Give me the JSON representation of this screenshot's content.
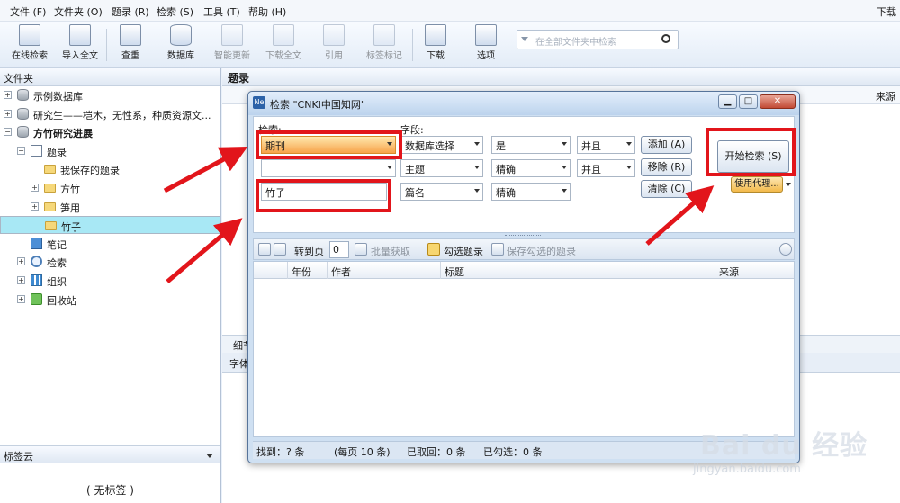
{
  "menubar": {
    "items": [
      "文件 (F)",
      "文件夹 (O)",
      "题录 (R)",
      "检索 (S)",
      "工具 (T)",
      "帮助 (H)"
    ],
    "right_text": "下载量"
  },
  "toolbar": {
    "buttons": [
      {
        "label": "在线检索",
        "icon": "online-search-icon",
        "enabled": true
      },
      {
        "label": "导入全文",
        "icon": "import-fulltext-icon",
        "enabled": true
      },
      {
        "label": "查重",
        "icon": "dedupe-icon",
        "enabled": true
      },
      {
        "label": "数据库",
        "icon": "database-icon",
        "enabled": true
      },
      {
        "label": "智能更新",
        "icon": "smart-update-icon",
        "enabled": false
      },
      {
        "label": "下载全文",
        "icon": "download-fulltext-icon",
        "enabled": false
      },
      {
        "label": "引用",
        "icon": "cite-icon",
        "enabled": false
      },
      {
        "label": "标签标记",
        "icon": "tag-icon",
        "enabled": false
      },
      {
        "label": "下载",
        "icon": "download-icon",
        "enabled": true
      },
      {
        "label": "选项",
        "icon": "options-icon",
        "enabled": true
      }
    ],
    "search_placeholder": "在全部文件夹中检索"
  },
  "left_panel": {
    "header": "文件夹",
    "tree": [
      {
        "label": "示例数据库",
        "icon": "database-icon",
        "level": 0,
        "expander": "+"
      },
      {
        "label": "研究生——桤木，无性系，种质资源文...",
        "icon": "database-icon",
        "level": 0,
        "expander": "+"
      },
      {
        "label": "方竹研究进展",
        "icon": "database-icon",
        "level": 0,
        "expander": "−",
        "bold": true
      },
      {
        "label": "题录",
        "icon": "list-icon",
        "level": 1,
        "expander": "−"
      },
      {
        "label": "我保存的题录",
        "icon": "folder-icon",
        "level": 2,
        "expander": ""
      },
      {
        "label": "方竹",
        "icon": "folder-icon",
        "level": 2,
        "expander": "+"
      },
      {
        "label": "笋用",
        "icon": "folder-icon",
        "level": 2,
        "expander": "+"
      },
      {
        "label": "竹子",
        "icon": "folder-icon",
        "level": 2,
        "expander": "",
        "selected": true
      },
      {
        "label": "笔记",
        "icon": "note-icon",
        "level": 1,
        "expander": ""
      },
      {
        "label": "检索",
        "icon": "search-icon",
        "level": 1,
        "expander": "+"
      },
      {
        "label": "组织",
        "icon": "organize-icon",
        "level": 1,
        "expander": "+"
      },
      {
        "label": "回收站",
        "icon": "recycle-bin-icon",
        "level": 1,
        "expander": "+"
      }
    ],
    "tagcloud_header": "标签云",
    "tagcloud_empty": "( 无标签 )"
  },
  "main": {
    "header": "题录",
    "col_source": "来源",
    "strip1": "细节",
    "strip2": "字体"
  },
  "dialog": {
    "title": "检索 \"CNKI中国知网\"",
    "logo": "Ne",
    "search_label": "检索:",
    "field_label": "字段:",
    "rows": [
      {
        "source": "期刊",
        "field": "数据库选择",
        "mode": "是",
        "logic": "并且",
        "value": ""
      },
      {
        "source": "",
        "field": "主题",
        "mode": "精确",
        "logic": "并且",
        "value": ""
      },
      {
        "source": "竹子",
        "field": "篇名",
        "mode": "精确",
        "logic": "",
        "value": ""
      }
    ],
    "btn_add": "添加 (A)",
    "btn_remove": "移除 (R)",
    "btn_clear": "清除 (C)",
    "btn_start": "开始检索 (S)",
    "btn_proxy": "使用代理...",
    "results_toolbar": {
      "goto_label": "转到页",
      "page": "0",
      "batch_fetch": "批量获取",
      "check_records": "勾选题录",
      "save_checked": "保存勾选的题录"
    },
    "table_headers": [
      "年份",
      "作者",
      "标题",
      "来源"
    ],
    "status": {
      "found": "找到：? 条",
      "per_page": "(每页 10 条)",
      "fetched": "已取回：0 条",
      "checked": "已勾选：0 条"
    }
  },
  "colors": {
    "highlight_red": "#e2151b",
    "selection_cyan": "#a8e8f5",
    "source_orange": "#f7a349"
  },
  "watermark": {
    "logo": "Bai du 经验",
    "url": "jingyan.baidu.com"
  }
}
